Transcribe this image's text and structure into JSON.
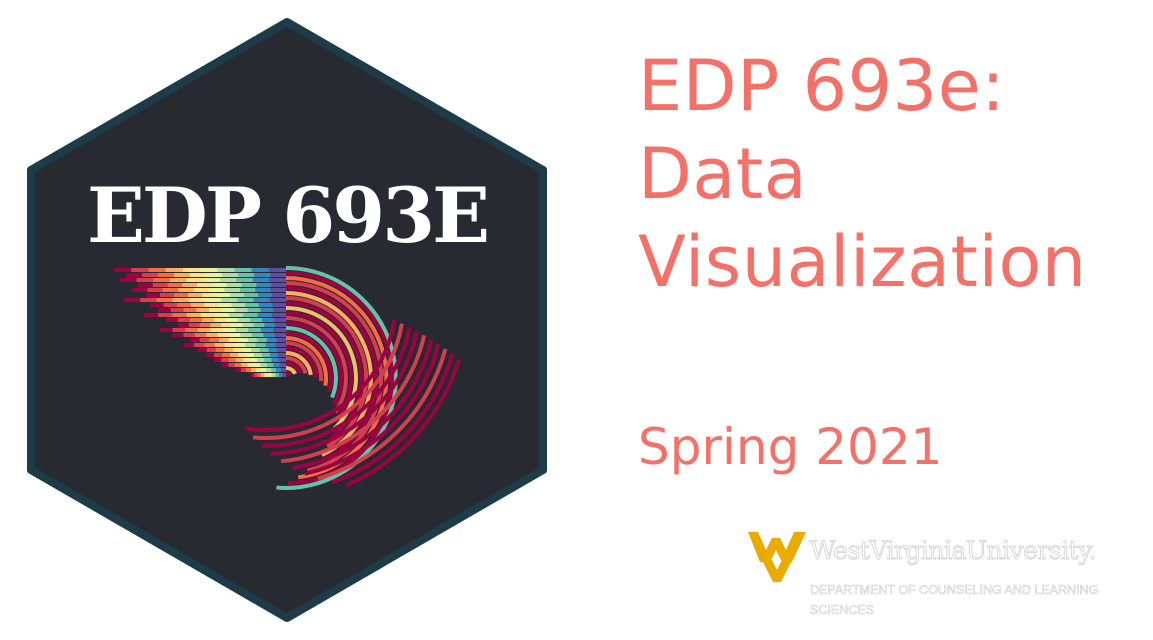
{
  "hex": {
    "title": "EDP 693E",
    "background_color": "#272a31",
    "border_color": "#1d3c48",
    "palette": [
      "#5e4fa2",
      "#3288bd",
      "#66c2a5",
      "#abdda4",
      "#e6f598",
      "#fee08b",
      "#fdae61",
      "#f46d43",
      "#d53e4f",
      "#9e0142"
    ]
  },
  "course": {
    "title_lines": [
      "EDP 693e:",
      "Data",
      "Visualization"
    ],
    "term": "Spring 2021",
    "accent_color": "#f4716a"
  },
  "institution": {
    "name": "WestVirginiaUniversity.",
    "department": "DEPARTMENT OF COUNSELING AND LEARNING SCIENCES",
    "logo_gold": "#eaaa00"
  }
}
